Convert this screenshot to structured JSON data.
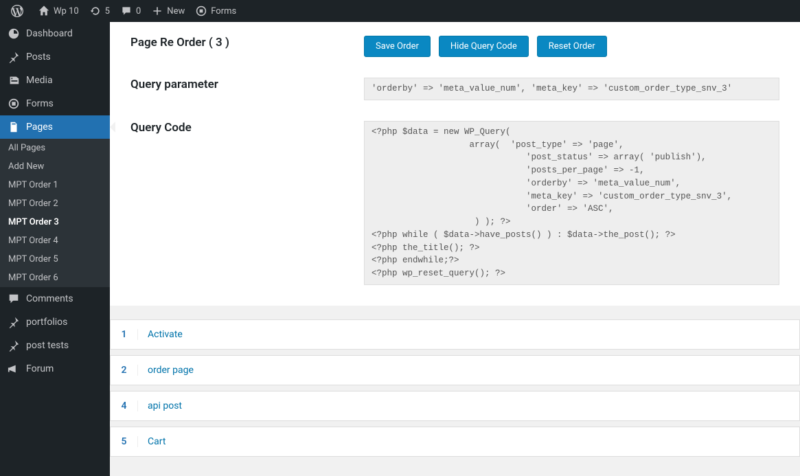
{
  "adminbar": {
    "site_name": "Wp 10",
    "updates": "5",
    "comments": "0",
    "new": "New",
    "forms": "Forms"
  },
  "menu": {
    "dashboard": "Dashboard",
    "posts": "Posts",
    "media": "Media",
    "forms": "Forms",
    "pages": "Pages",
    "pages_sub": {
      "all": "All Pages",
      "add": "Add New",
      "mpt1": "MPT Order 1",
      "mpt2": "MPT Order 2",
      "mpt3": "MPT Order 3",
      "mpt4": "MPT Order 4",
      "mpt5": "MPT Order 5",
      "mpt6": "MPT Order 6"
    },
    "comments": "Comments",
    "portfolios": "portfolios",
    "post_tests": "post tests",
    "forum": "Forum"
  },
  "page": {
    "heading": "Page Re Order ( 3 )",
    "btn_save": "Save Order",
    "btn_hide": "Hide Query Code",
    "btn_reset": "Reset Order",
    "query_param_label": "Query parameter",
    "query_param_value": "'orderby' => 'meta_value_num', 'meta_key' => 'custom_order_type_snv_3'",
    "query_code_label": "Query Code",
    "query_code_value": "<?php $data = new WP_Query(\n                   array(  'post_type' => 'page',\n                              'post_status' => array( 'publish'),\n                              'posts_per_page' => -1,\n                              'orderby' => 'meta_value_num',\n                              'meta_key' => 'custom_order_type_snv_3',\n                              'order' => 'ASC',\n                    ) ); ?>\n<?php while ( $data->have_posts() ) : $data->the_post(); ?>\n<?php the_title(); ?>\n<?php endwhile;?>\n<?php wp_reset_query(); ?>"
  },
  "list": [
    {
      "num": "1",
      "title": "Activate"
    },
    {
      "num": "2",
      "title": "order page"
    },
    {
      "num": "4",
      "title": "api post"
    },
    {
      "num": "5",
      "title": "Cart"
    }
  ]
}
